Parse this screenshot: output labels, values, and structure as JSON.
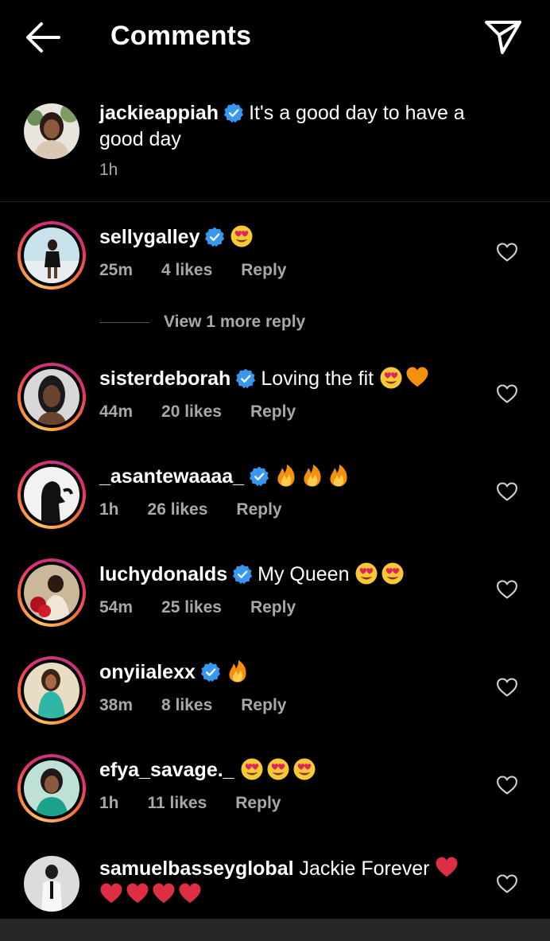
{
  "header": {
    "title": "Comments"
  },
  "caption": {
    "username": "jackieappiah",
    "text": "It's a good day to have a good day",
    "time": "1h"
  },
  "comments": [
    {
      "username": "sellygalley",
      "text": "",
      "time": "25m",
      "likes": "4 likes",
      "reply": "Reply",
      "emoji": [
        "heart-eyes"
      ]
    },
    {
      "username": "sisterdeborah",
      "text": "Loving the fit",
      "time": "44m",
      "likes": "20 likes",
      "reply": "Reply",
      "emoji": [
        "heart-eyes",
        "orange-heart"
      ]
    },
    {
      "username": "_asantewaaaa_",
      "text": "",
      "time": "1h",
      "likes": "26 likes",
      "reply": "Reply",
      "emoji": [
        "fire",
        "fire",
        "fire"
      ]
    },
    {
      "username": "luchydonalds",
      "text": "My Queen",
      "time": "54m",
      "likes": "25 likes",
      "reply": "Reply",
      "emoji": [
        "heart-eyes",
        "heart-eyes"
      ]
    },
    {
      "username": "onyiialexx",
      "text": "",
      "time": "38m",
      "likes": "8 likes",
      "reply": "Reply",
      "emoji": [
        "fire"
      ]
    },
    {
      "username": "efya_savage._",
      "text": "",
      "time": "1h",
      "likes": "11 likes",
      "reply": "Reply",
      "emoji": [
        "heart-eyes",
        "heart-eyes",
        "heart-eyes"
      ]
    },
    {
      "username": "samuelbasseyglobal",
      "text": "Jackie Forever",
      "emoji": [
        "red-heart",
        "red-heart",
        "red-heart",
        "red-heart",
        "red-heart"
      ]
    }
  ],
  "view_more": "View 1 more reply",
  "colors": {
    "background": "#000000",
    "verified": "#3897f0",
    "meta": "#a8a8a8"
  }
}
